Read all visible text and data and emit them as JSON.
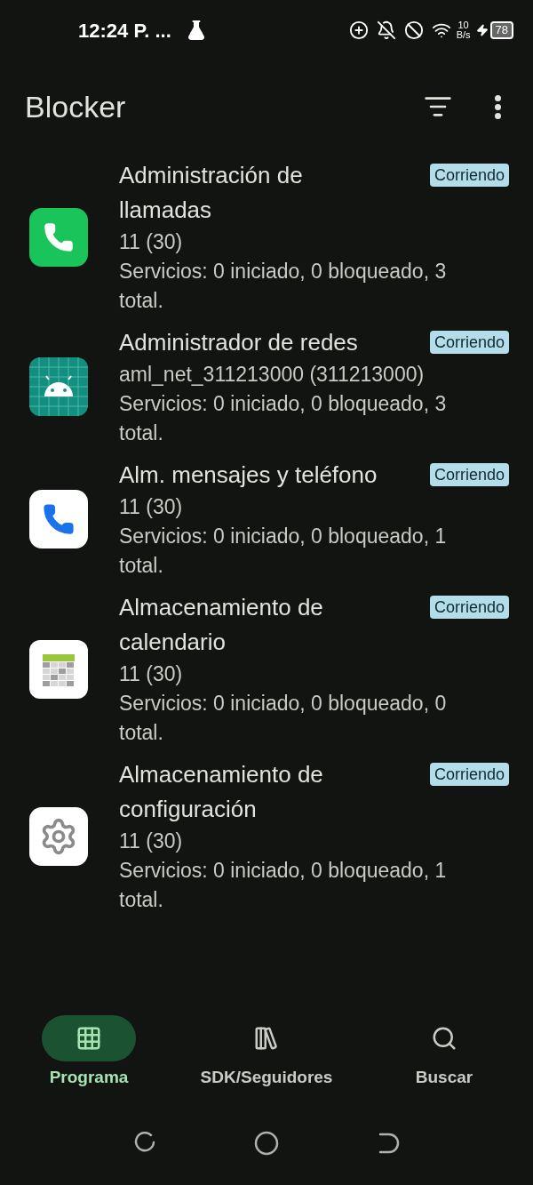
{
  "status_bar": {
    "time": "12:24 P. ...",
    "net_speed": "10",
    "net_unit": "B/s",
    "battery": "78"
  },
  "app_bar": {
    "title": "Blocker"
  },
  "apps": [
    {
      "kind": "phone-green",
      "name": "Administración de llamadas",
      "version": "11 (30)",
      "services": "Servicios: 0 iniciado, 0 bloqueado, 3 total.",
      "badge": "Corriendo"
    },
    {
      "kind": "android",
      "name": "Administrador de redes",
      "version": "aml_net_311213000 (311213000)",
      "services": "Servicios: 0 iniciado, 0 bloqueado, 3 total.",
      "badge": "Corriendo"
    },
    {
      "kind": "phone-blue",
      "name": "Alm. mensajes y teléfono",
      "version": "11 (30)",
      "services": "Servicios: 0 iniciado, 0 bloqueado, 1 total.",
      "badge": "Corriendo"
    },
    {
      "kind": "calendar",
      "name": "Almacenamiento de calendario",
      "version": "11 (30)",
      "services": "Servicios: 0 iniciado, 0 bloqueado, 0 total.",
      "badge": "Corriendo"
    },
    {
      "kind": "gear",
      "name": "Almacenamiento de configuración",
      "version": "11 (30)",
      "services": "Servicios: 0 iniciado, 0 bloqueado, 1 total.",
      "badge": "Corriendo"
    }
  ],
  "nav": [
    {
      "label": "Programa",
      "selected": true
    },
    {
      "label": "SDK/Seguidores",
      "selected": false
    },
    {
      "label": "Buscar",
      "selected": false
    }
  ]
}
